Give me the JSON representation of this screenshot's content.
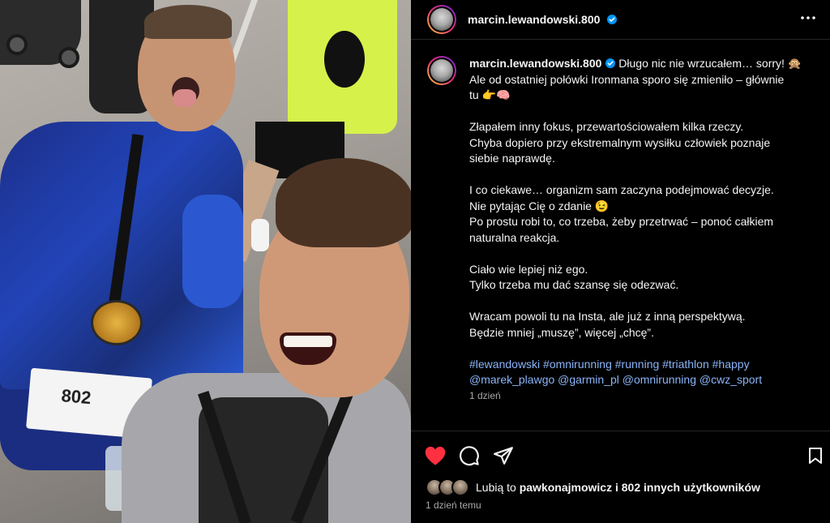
{
  "post": {
    "username": "marcin.lewandowski.800",
    "caption_lines": [
      "Długo nic nie wrzucałem… sorry! 🙊",
      "Ale od ostatniej połówki Ironmana sporo się zmieniło – głównie",
      "tu 👉🧠",
      "",
      "Złapałem inny fokus, przewartościowałem kilka rzeczy.",
      "Chyba dopiero przy ekstremalnym wysiłku człowiek poznaje",
      "siebie naprawdę.",
      "",
      "I co ciekawe… organizm sam zaczyna podejmować decyzje.",
      "Nie pytając Cię o zdanie 😉",
      "Po prostu robi to, co trzeba, żeby przetrwać – ponoć całkiem",
      "naturalna reakcja.",
      "",
      "Ciało wie lepiej niż ego.",
      "Tylko trzeba mu dać szansę się odezwać.",
      "",
      "Wracam powoli tu na Insta, ale już z inną perspektywą.",
      "Będzie mniej „muszę”, więcej „chcę”."
    ],
    "tags_line1": "#lewandowski #omnirunning #running #triathlon #happy",
    "tags_line2": "@marek_plawgo @garmin_pl @omnirunning @cwz_sport",
    "caption_age": "1 dzień",
    "photo_bib": "802"
  },
  "likes": {
    "prefix": "Lubią to ",
    "first_user": "pawkonajmowicz",
    "suffix": " i 802 innych użytkowników"
  },
  "timestamp": "1 dzień temu",
  "icons": {
    "like": "heart-filled-icon",
    "comment": "comment-icon",
    "share": "send-icon",
    "save": "bookmark-icon",
    "more": "more-horizontal-icon",
    "verified": "verified-badge-icon"
  },
  "colors": {
    "background": "#000000",
    "text": "#f5f5f5",
    "muted": "#a8a8a8",
    "link": "#8ab4f8",
    "like_red": "#ff3040",
    "verified_blue": "#0095f6"
  }
}
